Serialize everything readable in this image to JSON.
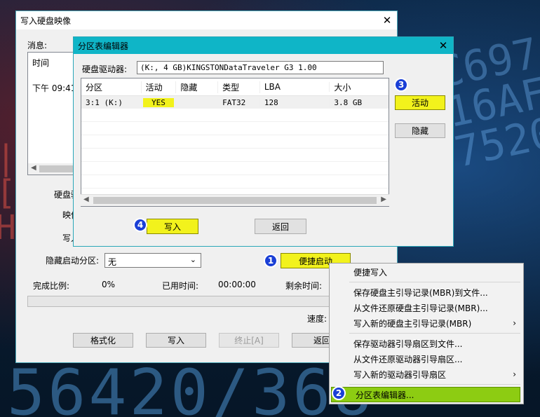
{
  "main_window": {
    "title": "写入硬盘映像",
    "message_label": "消息:",
    "time_header": "时间",
    "log_time": "下午 09:41",
    "hard_drive_label": "硬盘驱",
    "image_label": "映像",
    "write_label": "写入",
    "hide_boot_label": "隐藏启动分区:",
    "hide_boot_value": "无",
    "quick_boot_label": "便捷启动",
    "progress_label": "完成比例:",
    "progress_value": "0%",
    "elapsed_label": "已用时间:",
    "elapsed_value": "00:00:00",
    "remaining_label": "剩余时间:",
    "speed_label": "速度:",
    "format_btn": "格式化",
    "write_btn": "写入",
    "stop_btn": "终止[A]",
    "back_btn": "返回"
  },
  "editor": {
    "title": "分区表编辑器",
    "drive_label": "硬盘驱动器:",
    "drive_value": "(K:, 4 GB)KINGSTONDataTraveler G3 1.00",
    "columns": [
      "分区",
      "活动",
      "隐藏",
      "类型",
      "LBA",
      "大小"
    ],
    "rows": [
      {
        "partition": "3:1 (K:)",
        "active": "YES",
        "hidden": "",
        "type": "FAT32",
        "lba": "128",
        "size": "3.8 GB"
      }
    ],
    "active_btn": "活动",
    "hide_btn": "隐藏",
    "write_btn": "写入",
    "back_btn": "返回"
  },
  "context_menu": {
    "items": [
      {
        "label": "便捷写入",
        "submenu": false
      },
      {
        "label": "保存硬盘主引导记录(MBR)到文件...",
        "submenu": false
      },
      {
        "label": "从文件还原硬盘主引导记录(MBR)...",
        "submenu": false
      },
      {
        "label": "写入新的硬盘主引导记录(MBR)",
        "submenu": true
      },
      {
        "label": "保存驱动器引导扇区到文件...",
        "submenu": false
      },
      {
        "label": "从文件还原驱动器引导扇区...",
        "submenu": false
      },
      {
        "label": "写入新的驱动器引导扇区",
        "submenu": true
      },
      {
        "label": "分区表编辑器...",
        "submenu": false
      }
    ],
    "submenu_glyph": "›"
  },
  "badges": [
    "1",
    "2",
    "3",
    "4"
  ],
  "background_digits": "56420/368",
  "colors": {
    "highlight": "#f2f21c",
    "selected_menu": "#8dcc12",
    "badge": "#1a3fd6",
    "editor_title": "#0fb5c7"
  }
}
